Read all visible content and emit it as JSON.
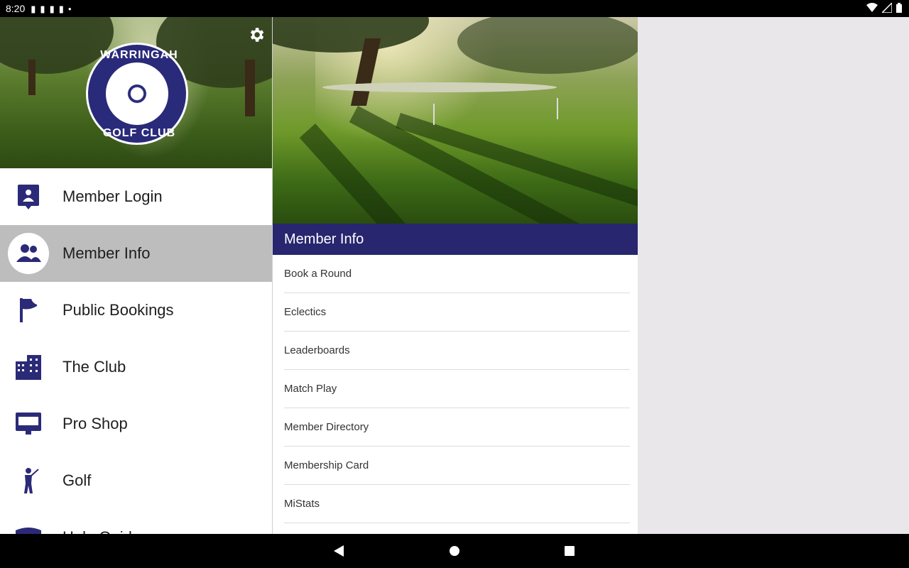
{
  "status_bar": {
    "time": "8:20"
  },
  "drawer": {
    "logo": {
      "top_text": "WARRINGAH",
      "bottom_text": "GOLF CLUB"
    },
    "items": [
      {
        "label": "Member Login",
        "icon": "member-login-icon"
      },
      {
        "label": "Member Info",
        "icon": "member-info-icon",
        "active": true
      },
      {
        "label": "Public Bookings",
        "icon": "flag-icon"
      },
      {
        "label": "The Club",
        "icon": "building-icon"
      },
      {
        "label": "Pro Shop",
        "icon": "shop-icon"
      },
      {
        "label": "Golf",
        "icon": "golfer-icon"
      },
      {
        "label": "Hole Guide",
        "icon": "hole-guide-icon"
      }
    ]
  },
  "panel": {
    "title": "Member Info",
    "items": [
      "Book a Round",
      "Eclectics",
      "Leaderboards",
      "Match Play",
      "Member Directory",
      "Membership Card",
      "MiStats"
    ]
  },
  "colors": {
    "brand": "#27266f",
    "active_bg": "#bdbdbe"
  }
}
